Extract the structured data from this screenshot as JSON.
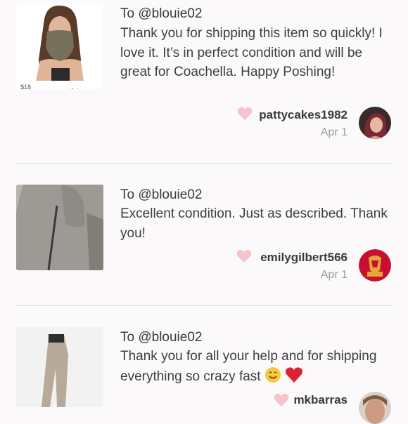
{
  "reviews": [
    {
      "to": "To @blouie02",
      "message": "Thank you for shipping this item so quickly! I love it. It’s in perfect condition and will be great for Coachella. Happy Poshing!",
      "author": "pattycakes1982",
      "date": "Apr 1",
      "price": "$18",
      "image_icon": "face-mask-photo"
    },
    {
      "to": "To @blouie02",
      "message": "Excellent condition. Just as described. Thank you!",
      "author": "emilygilbert566",
      "date": "Apr 1",
      "image_icon": "gray-jacket-photo"
    },
    {
      "to": "To @blouie02",
      "message": "Thank you for all your help and for shipping everything so crazy fast",
      "author": "mkbarras",
      "emoji": [
        "smile-emoji",
        "heart-emoji"
      ],
      "image_icon": "beige-leggings-photo"
    }
  ],
  "colors": {
    "heart": "#f6c3cc",
    "divider": "#dcdcdc",
    "background": "#fbf9fa",
    "date": "#9d9d9d"
  }
}
